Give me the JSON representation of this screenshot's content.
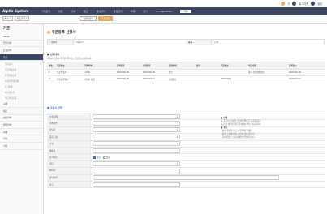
{
  "util": {
    "items": [
      "가",
      "로그아웃",
      "설정"
    ]
  },
  "topbar": {
    "brand": "Alpha System",
    "nav": [
      "거래관리",
      "영업",
      "구매",
      "재고",
      "생산관리",
      "품질관리",
      "회계",
      "인사",
      "Configuration",
      "기타"
    ],
    "active_index": 9
  },
  "subbar": {
    "btn_main": "Main",
    "btn_more": "바로가기",
    "tabs": [
      "거래처관리",
      "주문관리"
    ]
  },
  "sidebar": {
    "title": "기준",
    "items": [
      "Sales",
      "업무관리",
      "요청관리",
      "주문"
    ],
    "active": "주문",
    "subs": [
      "주문등록",
      "주문현황조회",
      "발행현황조회",
      "미지급발행현황",
      "입금현황",
      "세금계산서",
      "주문관리조회"
    ],
    "items2": [
      "구매",
      "재고",
      "생산관리",
      "영업관리",
      "회계",
      "인사",
      "기타"
    ]
  },
  "main": {
    "title": "주문등록 신청서",
    "search": {
      "label": "거래처",
      "value": "Search",
      "label2": "품목",
      "value2": "검색"
    },
    "section1": "■ 신청내역",
    "section1_desc": "거래처 신청서 내역을 확인하고 주문을 등록합니다.",
    "grid": {
      "headers": [
        "번호",
        "주문번호",
        "거래처명",
        "등록일자",
        "신청일자",
        "진행상태",
        "담당",
        "주문번호",
        "적요사항",
        "등록일시"
      ],
      "rows": [
        [
          "1",
          "주문번호A",
          "거래처",
          "2020.06.18",
          "2020.06.18",
          "접수",
          "",
          "",
          "품목 주문확인완료",
          "2020.06.18"
        ],
        [
          "2",
          "주문등록일시",
          "거래처 분류",
          "2020.06.18",
          "2020.07.01",
          "신청완료",
          "",
          "2020.06.1",
          "",
          "2020.07.01"
        ]
      ]
    },
    "section2": "■ 주문서 신청",
    "form": [
      {
        "label": "신청 유형",
        "value": "",
        "select": true
      },
      {
        "label": "거래처명",
        "value": "",
        "select": false
      },
      {
        "label": "담당자",
        "value": "",
        "select": true
      },
      {
        "label": "품목 구분",
        "value": "",
        "select": true
      },
      {
        "label": "수량",
        "value": "",
        "select": true
      },
      {
        "label": "배송지",
        "value": "",
        "select": false
      },
      {
        "label": "납기일자",
        "value": "",
        "select": false
      },
      {
        "label": "기타",
        "value": "",
        "select": true
      },
      {
        "label": "Email",
        "value": "",
        "select": false
      },
      {
        "label": "첨부파일",
        "value": "",
        "select": false
      },
      {
        "label": "비고",
        "value": "",
        "select": false
      }
    ],
    "notes_h1": "■ 안내",
    "notes1": [
      "1. 주문서 신청 후 담당자 확인 후 등록됩니다.",
      "2. 신청 내역은 주문관리에서 확인 가능합니다."
    ],
    "notes_h2": "■ 참고",
    "notes2": [
      "- 필수 항목을 반드시 입력해 주세요.",
      "- 품목 구분에 따라 승인이 필요합니다.",
      "- 문의사항은 담당자에게 연락바랍니다."
    ],
    "radio_label": "사업자 번호",
    "radio_options": [
      "있음",
      "없음"
    ]
  },
  "colors": {
    "topbar": "#3b4560",
    "accent": "#e6a95a",
    "active_side": "#3b4560"
  }
}
